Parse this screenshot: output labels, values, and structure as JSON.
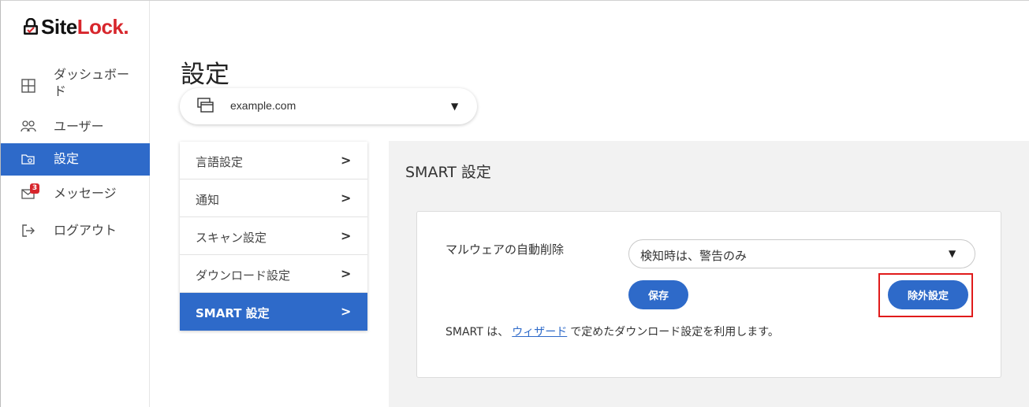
{
  "brand": {
    "logo_prefix": "Site",
    "logo_lock": "Lock",
    "logo_dot": ".",
    "accent_color": "#2e6ac9",
    "brand_red": "#d7262c"
  },
  "sidebar": {
    "items": [
      {
        "label": "ダッシュボード",
        "icon": "grid-icon"
      },
      {
        "label": "ユーザー",
        "icon": "users-icon"
      },
      {
        "label": "設定",
        "icon": "settings-folder-icon",
        "active": true
      },
      {
        "label": "メッセージ",
        "icon": "mail-icon",
        "badge": "3"
      },
      {
        "label": "ログアウト",
        "icon": "logout-icon"
      }
    ]
  },
  "page": {
    "title": "設定",
    "domain": "example.com"
  },
  "settings_menu": {
    "items": [
      {
        "label": "言語設定"
      },
      {
        "label": "通知"
      },
      {
        "label": "スキャン設定"
      },
      {
        "label": "ダウンロード設定"
      },
      {
        "label": "SMART 設定",
        "active": true
      }
    ]
  },
  "smart": {
    "title": "SMART 設定",
    "malware_label": "マルウェアの自動削除",
    "malware_value": "検知時は、警告のみ",
    "save_label": "保存",
    "exclude_label": "除外設定",
    "note_prefix": "SMART は、",
    "note_link": "ウィザード",
    "note_suffix": "で定めたダウンロード設定を利用します。"
  }
}
